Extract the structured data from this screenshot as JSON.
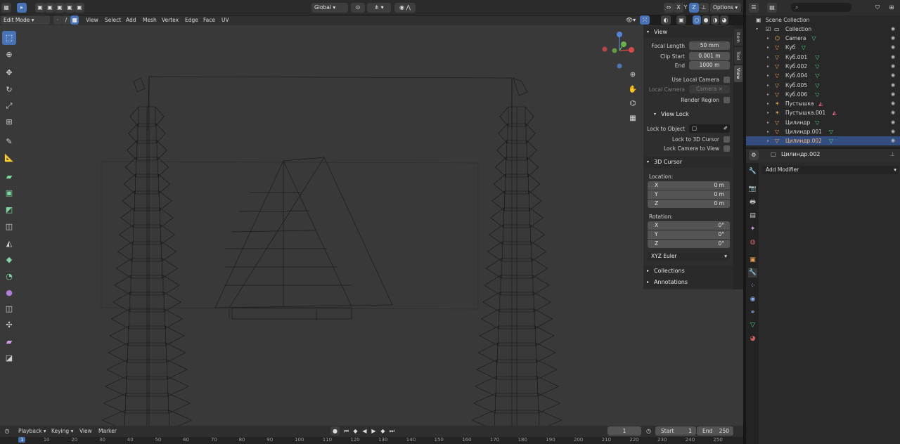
{
  "header": {
    "orientation": "Global",
    "axes": [
      "X",
      "Y",
      "Z"
    ],
    "options_label": "Options"
  },
  "view_header": {
    "mode": "Edit Mode",
    "menus": [
      "View",
      "Select",
      "Add",
      "Mesh",
      "Vertex",
      "Edge",
      "Face",
      "UV"
    ]
  },
  "npanel": {
    "tabs": [
      "Item",
      "Tool",
      "View"
    ],
    "view_title": "View",
    "focal_length_label": "Focal Length",
    "focal_length": "50 mm",
    "clip_start_label": "Clip Start",
    "clip_start": "0.001 m",
    "end_label": "End",
    "end": "1000 m",
    "use_local_camera": "Use Local Camera",
    "local_camera_label": "Local Camera",
    "local_camera_value": "Camera",
    "render_region": "Render Region",
    "view_lock_title": "View Lock",
    "lock_to_object": "Lock to Object",
    "lock_to_3d_cursor": "Lock to 3D Cursor",
    "lock_camera_to_view": "Lock Camera to View",
    "cursor_title": "3D Cursor",
    "location_label": "Location:",
    "location": [
      {
        "k": "X",
        "v": "0 m"
      },
      {
        "k": "Y",
        "v": "0 m"
      },
      {
        "k": "Z",
        "v": "0 m"
      }
    ],
    "rotation_label": "Rotation:",
    "rotation": [
      {
        "k": "X",
        "v": "0°"
      },
      {
        "k": "Y",
        "v": "0°"
      },
      {
        "k": "Z",
        "v": "0°"
      }
    ],
    "rotation_mode": "XYZ Euler",
    "collections": "Collections",
    "annotations": "Annotations"
  },
  "outliner": {
    "scene_collection": "Scene Collection",
    "collection": "Collection",
    "items": [
      {
        "name": "Camera",
        "icon": "camera-icon",
        "color": "#e8a050"
      },
      {
        "name": "Куб",
        "icon": "mesh-icon",
        "color": "#e8a050"
      },
      {
        "name": "Куб.001",
        "icon": "mesh-icon",
        "color": "#e8a050"
      },
      {
        "name": "Куб.002",
        "icon": "mesh-icon",
        "color": "#e8a050"
      },
      {
        "name": "Куб.004",
        "icon": "mesh-icon",
        "color": "#e8a050"
      },
      {
        "name": "Куб.005",
        "icon": "mesh-icon",
        "color": "#e8a050"
      },
      {
        "name": "Куб.006",
        "icon": "mesh-icon",
        "color": "#e8a050"
      },
      {
        "name": "Пустышка",
        "icon": "empty-icon",
        "color": "#e8a050"
      },
      {
        "name": "Пустышка.001",
        "icon": "empty-icon",
        "color": "#e8a050"
      },
      {
        "name": "Цилиндр",
        "icon": "mesh-icon",
        "color": "#e8a050"
      },
      {
        "name": "Цилиндр.001",
        "icon": "mesh-icon",
        "color": "#e8a050"
      },
      {
        "name": "Цилиндр.002",
        "icon": "mesh-icon",
        "color": "#e8a050",
        "selected": true
      }
    ]
  },
  "properties": {
    "object_name": "Цилиндр.002",
    "add_modifier": "Add Modifier"
  },
  "timeline": {
    "menus": [
      "Playback",
      "Keying",
      "View",
      "Marker"
    ],
    "current_frame": "1",
    "start_label": "Start",
    "start": "1",
    "end_label": "End",
    "end": "250",
    "ticks": [
      "1",
      "10",
      "20",
      "30",
      "40",
      "50",
      "60",
      "70",
      "80",
      "90",
      "100",
      "110",
      "120",
      "130",
      "140",
      "150",
      "160",
      "170",
      "180",
      "190",
      "200",
      "210",
      "220",
      "230",
      "240",
      "250"
    ]
  },
  "colors": {
    "accent": "#4772b3",
    "selection": "#334d80",
    "mesh_icon": "#e8a050",
    "data_icon": "#4fd47d"
  }
}
